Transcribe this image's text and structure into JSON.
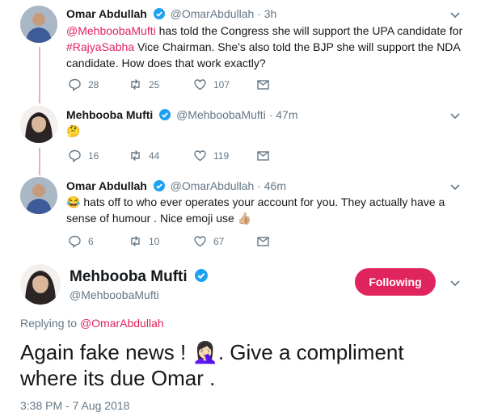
{
  "tweets": [
    {
      "name": "Omar Abdullah",
      "handle": "@OmarAbdullah",
      "separator": "·",
      "time": "3h",
      "text_parts": [
        {
          "t": "@MehboobaMufti",
          "link": true
        },
        {
          "t": " has told the Congress she will support the UPA candidate for ",
          "link": false
        },
        {
          "t": "#RajyaSabha",
          "link": true
        },
        {
          "t": " Vice Chairman. She's also told the BJP she will support the NDA candidate. How does that work exactly?",
          "link": false
        }
      ],
      "replies": "28",
      "retweets": "25",
      "likes": "107"
    },
    {
      "name": "Mehbooba Mufti",
      "handle": "@MehboobaMufti",
      "separator": "·",
      "time": "47m",
      "emoji": "🤔",
      "replies": "16",
      "retweets": "44",
      "likes": "119"
    },
    {
      "name": "Omar Abdullah",
      "handle": "@OmarAbdullah",
      "separator": "·",
      "time": "46m",
      "emoji_lead": "😂",
      "text": " hats off to who ever operates your account for you. They actually have a sense of humour . Nice emoji use ",
      "emoji_tail": "👍🏼",
      "replies": "6",
      "retweets": "10",
      "likes": "67"
    }
  ],
  "main": {
    "name": "Mehbooba Mufti",
    "handle": "@MehboobaMufti",
    "follow_label": "Following",
    "replying_prefix": "Replying to ",
    "replying_to": "@OmarAbdullah",
    "text_a": "Again fake news ! ",
    "emoji": "🤦🏻‍♀️",
    "text_b": ". Give a compliment where its due Omar .",
    "timestamp": "3:38 PM - 7 Aug 2018"
  },
  "colors": {
    "accent": "#e0245e",
    "verified": "#1da1f2",
    "muted": "#657786",
    "thread": "#e3b4b6"
  },
  "icons": [
    "reply-icon",
    "retweet-icon",
    "like-icon",
    "dm-icon",
    "verified-icon",
    "chevron-down-icon"
  ]
}
